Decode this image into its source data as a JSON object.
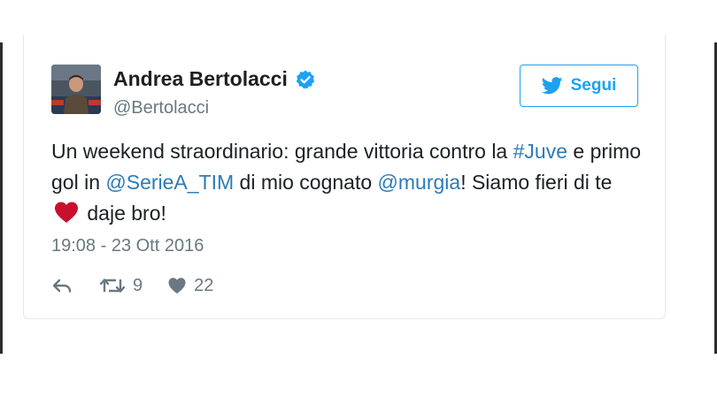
{
  "tweet": {
    "author": {
      "name": "Andrea Bertolacci",
      "handle": "@Bertolacci",
      "verified": true
    },
    "follow_label": "Segui",
    "text": {
      "part1": "Un weekend straordinario: grande vittoria contro la ",
      "hashtag": "#Juve",
      "part2": " e primo gol in ",
      "mention1": "@SerieA_TIM",
      "part3": " di mio cognato ",
      "mention2": "@murgia",
      "part4": "! Siamo fieri di te ",
      "part5": " daje bro!"
    },
    "timestamp": "19:08 - 23 Ott 2016",
    "retweets": "9",
    "likes": "22"
  },
  "colors": {
    "link": "#2b7bb9",
    "twitter_blue": "#1da1f2",
    "muted": "#697882",
    "heart": "#e0245e"
  },
  "icons": {
    "verified": "verified-badge-icon",
    "bird": "twitter-bird-icon",
    "reply": "reply-arrow-icon",
    "retweet": "retweet-icon",
    "like": "heart-icon",
    "emoji": "red-heart-emoji"
  }
}
